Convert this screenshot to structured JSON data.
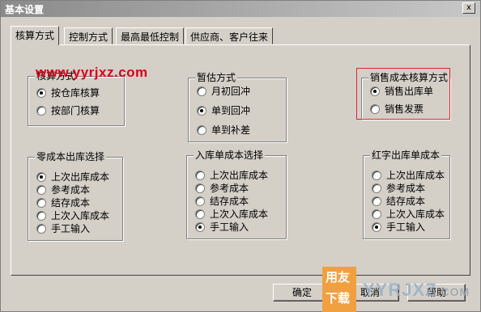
{
  "window": {
    "title": "基本设置",
    "close_glyph": "x"
  },
  "tabs": [
    {
      "label": "核算方式",
      "active": true
    },
    {
      "label": "控制方式",
      "active": false
    },
    {
      "label": "最高最低控制",
      "active": false
    },
    {
      "label": "供应商、客户往来",
      "active": false
    }
  ],
  "groups": {
    "costing_method": {
      "title": "核算方式",
      "options": [
        "按仓库核算",
        "按部门核算"
      ],
      "selected": 0
    },
    "estimate_method": {
      "title": "暂估方式",
      "options": [
        "月初回冲",
        "单到回冲",
        "单到补差"
      ],
      "selected": 1
    },
    "sales_cost_method": {
      "title": "销售成本核算方式",
      "options": [
        "销售出库单",
        "销售发票"
      ],
      "selected": 0
    },
    "zero_cost_outbound": {
      "title": "零成本出库选择",
      "options": [
        "上次出库成本",
        "参考成本",
        "结存成本",
        "上次入库成本",
        "手工输入"
      ],
      "selected": 0
    },
    "inbound_cost": {
      "title": "入库单成本选择",
      "options": [
        "上次出库成本",
        "参考成本",
        "结存成本",
        "上次入库成本",
        "手工输入"
      ],
      "selected": 4
    },
    "red_outbound_cost": {
      "title": "红字出库单成本",
      "options": [
        "上次出库成本",
        "参考成本",
        "结存成本",
        "上次入库成本",
        "手工输入"
      ],
      "selected": 4
    }
  },
  "buttons": {
    "ok": "确定",
    "cancel": "取消",
    "help": "帮助"
  },
  "watermark": {
    "text": "www.yyrjxz.com"
  },
  "logo": {
    "line1": "用友",
    "line2": "下载",
    "mark": "YYRJXZ",
    "mark_suffix": ".COM"
  },
  "colors": {
    "face": "#d4d0c8",
    "watermark": "#d9001b",
    "highlight": "#e0242b",
    "logo": "#f0a040"
  }
}
